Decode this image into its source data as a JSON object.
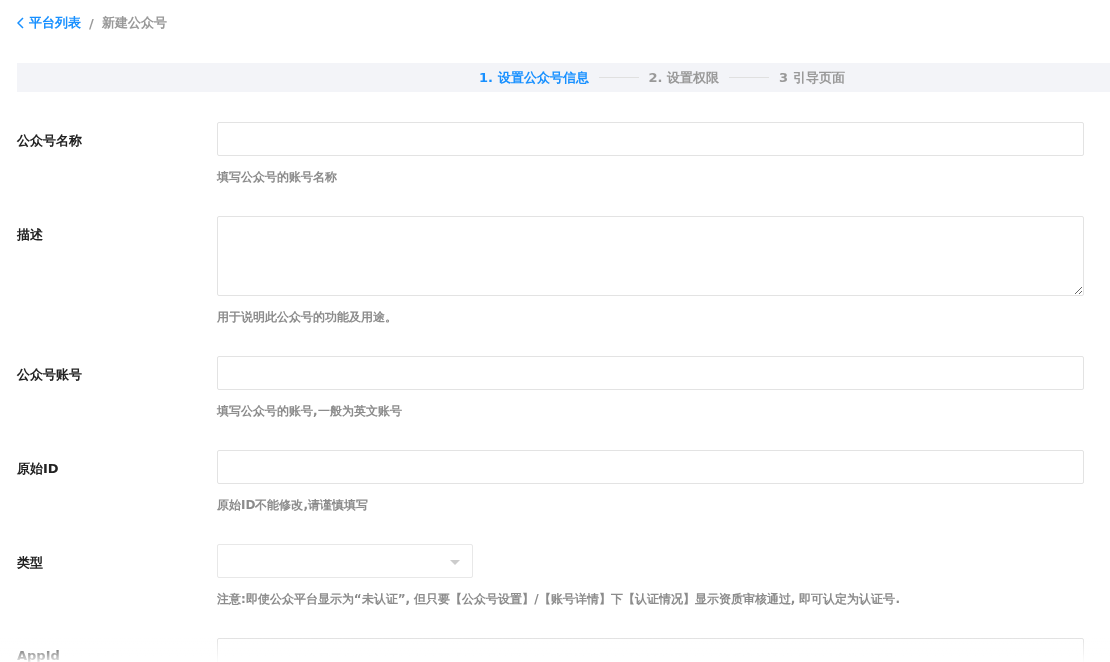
{
  "breadcrumb": {
    "back_label": "平台列表",
    "separator": "/",
    "current": "新建公众号"
  },
  "steps": [
    {
      "label": "1. 设置公众号信息",
      "selected": true
    },
    {
      "label": "2. 设置权限",
      "selected": false
    },
    {
      "label": "3 引导页面",
      "selected": false
    }
  ],
  "fields": [
    {
      "kind": "input",
      "label": "公众号名称",
      "hint": "填写公众号的账号名称"
    },
    {
      "kind": "textarea",
      "label": "描述",
      "hint": "用于说明此公众号的功能及用途。"
    },
    {
      "kind": "input",
      "label": "公众号账号",
      "hint": "填写公众号的账号,一般为英文账号"
    },
    {
      "kind": "input",
      "label": "原始ID",
      "hint": "原始ID不能修改,请谨慎填写"
    },
    {
      "kind": "select",
      "label": "类型",
      "hint": "注意:即使公众平台显示为“未认证”, 但只要【公众号设置】/【账号详情】下【认证情况】显示资质审核通过, 即可认定为认证号."
    },
    {
      "kind": "input",
      "label": "AppId"
    }
  ]
}
